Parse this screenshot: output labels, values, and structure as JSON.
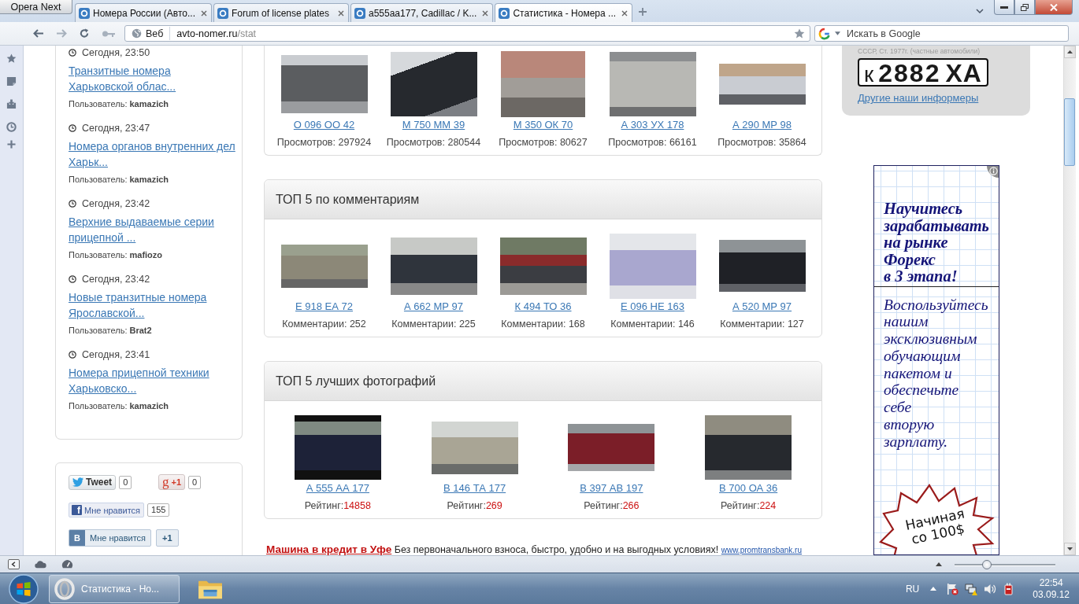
{
  "browser": {
    "menu_button": "Opera Next",
    "tabs": [
      {
        "title": "Номера России (Авто...",
        "selected": false
      },
      {
        "title": "Forum of license plates",
        "selected": false
      },
      {
        "title": "a555aa177, Cadillac / K...",
        "selected": false
      },
      {
        "title": "Статистика - Номера ...",
        "selected": true
      }
    ],
    "address": {
      "mode": "Веб",
      "host": "avto-nomer.ru",
      "path": "/stat"
    },
    "search": {
      "placeholder": "Искать в Google"
    },
    "zoom": {
      "level": 0.32
    }
  },
  "recent_posts": [
    {
      "time": "Сегодня, 23:50",
      "title": "Транзитные номера Харьковской облас...",
      "user": "Пользователь: **kamazich**"
    },
    {
      "time": "Сегодня, 23:47",
      "title": "Номера органов внутренних дел Харьк...",
      "user": "Пользователь: **kamazich**"
    },
    {
      "time": "Сегодня, 23:42",
      "title": "Верхние выдаваемые серии прицепной ...",
      "user": "Пользователь: **mafiozo**"
    },
    {
      "time": "Сегодня, 23:42",
      "title": "Новые транзитные номера Ярославской...",
      "user": "Пользователь: **Brat2**"
    },
    {
      "time": "Сегодня, 23:41",
      "title": "Номера прицепной техники Харьковско...",
      "user": "Пользователь: **kamazich**"
    }
  ],
  "social": [
    {
      "kind": "twitter",
      "label": "Tweet",
      "count": "0"
    },
    {
      "kind": "gplus",
      "logo": "g",
      "label": "+1",
      "count": "0"
    },
    {
      "kind": "facebook",
      "logo": "f",
      "label": "Мне нравится",
      "count": "155"
    },
    {
      "kind": "vk",
      "logo": "В",
      "label": "Мне нравится",
      "count": "+1"
    }
  ],
  "sections": [
    {
      "kind": "count",
      "items": [
        {
          "plate": "О 096 ОО 42",
          "stat": "Просмотров: 297924"
        },
        {
          "plate": "М 750 ММ 39",
          "stat": "Просмотров: 280544"
        },
        {
          "plate": "М 350 ОК 70",
          "stat": "Просмотров: 80627"
        },
        {
          "plate": "А 303 УХ 178",
          "stat": "Просмотров: 66161"
        },
        {
          "plate": "А 290 МР 98",
          "stat": "Просмотров: 35864"
        }
      ]
    },
    {
      "kind": "count",
      "title": "ТОП 5 по комментариям",
      "items": [
        {
          "plate": "Е 918 ЕА 72",
          "stat": "Комментарии: 252"
        },
        {
          "plate": "А 662 МР 97",
          "stat": "Комментарии: 225"
        },
        {
          "plate": "К 494 ТО 36",
          "stat": "Комментарии: 168"
        },
        {
          "plate": "Е 096 НЕ 163",
          "stat": "Комментарии: 146"
        },
        {
          "plate": "А 520 МР 97",
          "stat": "Комментарии: 127"
        }
      ]
    },
    {
      "kind": "rating",
      "title": "ТОП 5 лучших фотографий",
      "items": [
        {
          "plate": "А 555 АА 177",
          "stat_label": "Рейтинг:",
          "stat_value": "14858"
        },
        {
          "plate": "В 146 ТА 177",
          "stat_label": "Рейтинг:",
          "stat_value": "269"
        },
        {
          "plate": "В 397 АВ 197",
          "stat_label": "Рейтинг:",
          "stat_value": "266"
        },
        {
          "plate": "В 700 ОА 36",
          "stat_label": "Рейтинг:",
          "stat_value": "224"
        }
      ]
    }
  ],
  "ad_line": {
    "link": "Машина в кредит в Уфе",
    "text": "Без первоначального взноса, быстро, удобно и на выгодных условиях!",
    "url": "www.promtransbank.ru"
  },
  "informer": {
    "caption": "СССР, Ст. 1977г. (частные автомобили)",
    "plate": {
      "series": "к",
      "number": "2882",
      "region": "ХА"
    },
    "link": "Другие наши информеры"
  },
  "banner": {
    "headline": "Научитесь\nзарабатывать\nна рынке\nФорекс\nв 3 этапа!",
    "body": "Воспользуйтесь\nнашим\nэксклюзивным\nобучающим\nпакетом и\nобеспечьте\nсебе\nвторую\nзарплату.",
    "badge": [
      "Начиная",
      "со 100$"
    ]
  },
  "taskbar": {
    "tasks": [
      {
        "kind": "opera",
        "title": "Статистика - Но...",
        "selected": true
      },
      {
        "kind": "explorer",
        "selected": false
      }
    ],
    "language": "RU",
    "time": "22:54",
    "date": "03.09.12"
  }
}
